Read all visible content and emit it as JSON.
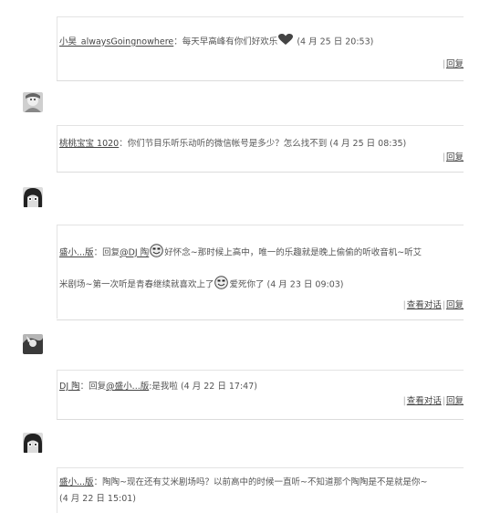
{
  "comments": [
    {
      "user": "小昊_alwaysGoingnowhere",
      "colon": "：",
      "text": "每天早高峰有你们好欢乐",
      "time": "(4 月 25 日  20:53)",
      "reply": "回复",
      "emoji": "heart-icon"
    },
    {
      "user": "桃桃宝宝 1020",
      "colon": "：",
      "text": "你们节目乐听乐动听的微信帐号是多少？怎么找不到",
      "time": "(4 月 25 日  08:35)",
      "reply": "回复"
    },
    {
      "user": "盛小...版",
      "colon": "：",
      "reply_prefix": "回复",
      "mention": "@DJ 陶",
      "text_a": "好怀念~那时候上高中，唯一的乐趣就是晚上偷偷的听收音机~听艾",
      "text_b": "米剧场~第一次听是青春继续就喜欢上了",
      "text_c": "爱死你了",
      "time": "(4 月 23 日  09:03)",
      "view_thread": "查看对话",
      "reply": "回复",
      "emoji": "smiley-icon"
    },
    {
      "user": "DJ 陶",
      "colon": "：",
      "reply_prefix": "回复",
      "mention": "@盛小...版",
      "text": ":是我啦",
      "time": "(4 月 22 日  17:47)",
      "view_thread": "查看对话",
      "reply": "回复"
    },
    {
      "user": "盛小...版",
      "colon": "：",
      "text": "陶陶~现在还有艾米剧场吗？以前高中的时候一直听~不知道那个陶陶是不是就是你~",
      "time": "(4 月 22 日  15:01)"
    }
  ],
  "separator": "|"
}
